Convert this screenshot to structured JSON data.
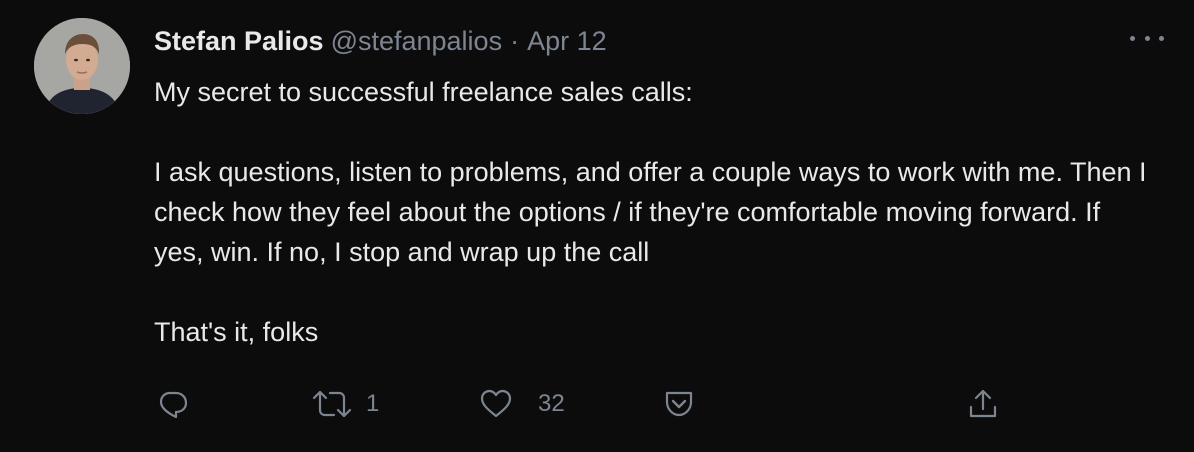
{
  "author": {
    "name": "Stefan Palios",
    "handle": "@stefanpalios",
    "separator": "·",
    "date": "Apr 12"
  },
  "tweet": {
    "paragraphs": [
      "My secret to successful freelance sales calls:",
      "I ask questions, listen to problems, and offer a couple ways to work with me. Then I check how they feel about the options / if they're comfortable moving forward. If yes, win. If no, I stop and wrap up the call",
      "That's it, folks"
    ]
  },
  "actions": {
    "reply": {
      "icon": "reply-icon"
    },
    "retweet": {
      "icon": "retweet-icon",
      "count": "1"
    },
    "like": {
      "icon": "heart-icon",
      "count": "32"
    },
    "save": {
      "icon": "pocket-save-icon"
    },
    "share": {
      "icon": "share-icon"
    }
  },
  "colors": {
    "background": "#0d0c0d",
    "text": "#e7e9ea",
    "secondary": "#7d8590"
  }
}
